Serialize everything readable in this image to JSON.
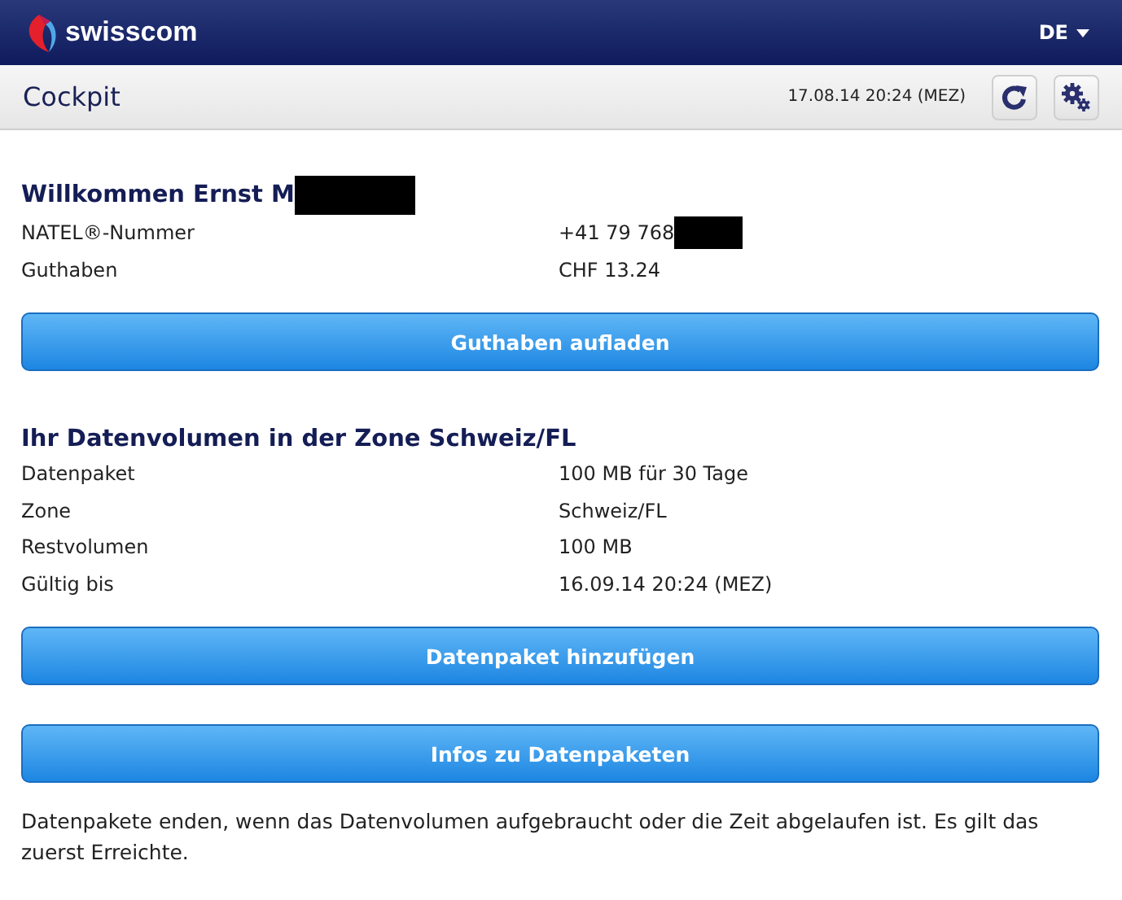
{
  "header": {
    "brand": "swisscom",
    "language": "DE"
  },
  "toolbar": {
    "title": "Cockpit",
    "timestamp": "17.08.14 20:24 (MEZ)"
  },
  "account": {
    "heading": "Willkommen Ernst M",
    "heading_redacted": true,
    "rows": [
      {
        "label": "NATEL®-Nummer",
        "value": "+41 79 768",
        "redacted": true
      },
      {
        "label": "Guthaben",
        "value": "CHF 13.24",
        "redacted": false
      }
    ],
    "button": "Guthaben aufladen"
  },
  "data_volume": {
    "heading": "Ihr Datenvolumen in der Zone Schweiz/FL",
    "rows": [
      {
        "label": "Datenpaket",
        "value": "100 MB für 30 Tage"
      },
      {
        "label": "Zone",
        "value": "Schweiz/FL"
      },
      {
        "label": "Restvolumen",
        "value": "100 MB"
      },
      {
        "label": "Gültig bis",
        "value": "16.09.14 20:24 (MEZ)"
      }
    ],
    "buttons": [
      "Datenpaket hinzufügen",
      "Infos zu Datenpaketen"
    ],
    "note": "Datenpakete enden, wenn das Datenvolumen aufgebraucht oder die Zeit abgelaufen ist. Es gilt das zuerst Erreichte."
  }
}
